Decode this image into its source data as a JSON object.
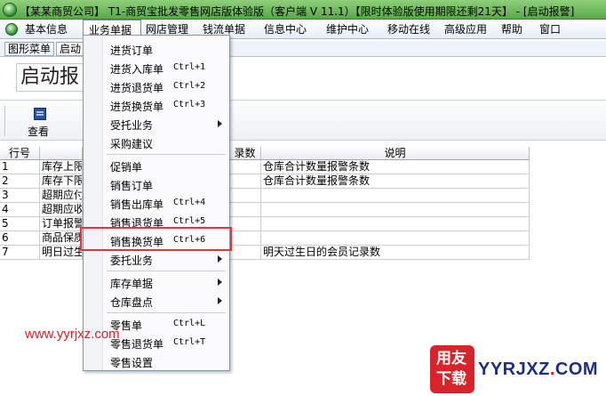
{
  "window": {
    "title": "【某某商贸公司】 T1-商贸宝批发零售网店版体验版（客户端 V 11.1）【限时体验版使用期限还剩21天】 - [启动报警]"
  },
  "menubar": {
    "items": [
      {
        "label": "基本信息"
      },
      {
        "label": "业务单据"
      },
      {
        "label": "网店管理"
      },
      {
        "label": "钱流单据"
      },
      {
        "label": "信息中心"
      },
      {
        "label": "维护中心"
      },
      {
        "label": "移动在线"
      },
      {
        "label": "高级应用"
      },
      {
        "label": "帮助"
      },
      {
        "label": "窗口"
      }
    ]
  },
  "tabs": [
    {
      "label": "图形菜单"
    },
    {
      "label": "启动"
    }
  ],
  "panel_title": "启动报",
  "toolbar": {
    "view_label": "查看"
  },
  "grid": {
    "columns": [
      "行号",
      "",
      "录数",
      "说明"
    ],
    "rows": [
      {
        "no": "1",
        "name": "库存上限",
        "desc": "仓库合计数量报警条数"
      },
      {
        "no": "2",
        "name": "库存下限",
        "desc": "仓库合计数量报警条数"
      },
      {
        "no": "3",
        "name": "超期应付",
        "desc": ""
      },
      {
        "no": "4",
        "name": "超期应收",
        "desc": ""
      },
      {
        "no": "5",
        "name": "订单报警",
        "desc": ""
      },
      {
        "no": "6",
        "name": "商品保质",
        "desc": ""
      },
      {
        "no": "7",
        "name": "明日过生",
        "desc": "明天过生日的会员记录数"
      }
    ]
  },
  "dropdown": {
    "items": [
      {
        "label": "进货订单",
        "shortcut": ""
      },
      {
        "label": "进货入库单",
        "shortcut": "Ctrl+1"
      },
      {
        "label": "进货退货单",
        "shortcut": "Ctrl+2"
      },
      {
        "label": "进货换货单",
        "shortcut": "Ctrl+3"
      },
      {
        "label": "受托业务",
        "shortcut": ""
      },
      {
        "label": "采购建议",
        "shortcut": ""
      },
      {
        "label": "促销单",
        "shortcut": ""
      },
      {
        "label": "销售订单",
        "shortcut": ""
      },
      {
        "label": "销售出库单",
        "shortcut": "Ctrl+4"
      },
      {
        "label": "销售退货单",
        "shortcut": "Ctrl+5"
      },
      {
        "label": "销售换货单",
        "shortcut": "Ctrl+6"
      },
      {
        "label": "委托业务",
        "shortcut": ""
      },
      {
        "label": "库存单据",
        "shortcut": ""
      },
      {
        "label": "仓库盘点",
        "shortcut": ""
      },
      {
        "label": "零售单",
        "shortcut": "Ctrl+L"
      },
      {
        "label": "零售退货单",
        "shortcut": "Ctrl+T"
      },
      {
        "label": "零售设置",
        "shortcut": ""
      }
    ]
  },
  "watermark": {
    "url": "www.yyrjxz.com",
    "logo_line1": "用友",
    "logo_line2": "下载",
    "logo_text": "YYRJXZ",
    "logo_dot": ".",
    "logo_tld": "COM"
  },
  "colors": {
    "titlebar": "#6fbf5f",
    "highlight": "#e0353a",
    "watermark_red": "#d8232a",
    "watermark_blue": "#1a2f88"
  }
}
